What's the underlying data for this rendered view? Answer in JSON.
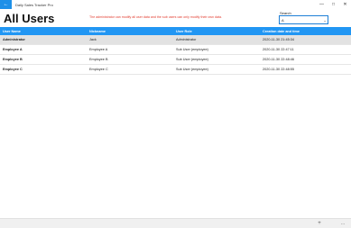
{
  "window": {
    "app_title": "Daily Sales Tracker Pro",
    "back_icon": "←",
    "minimize_icon": "—",
    "maximize_icon": "□",
    "close_icon": "✕"
  },
  "header": {
    "title": "All Users",
    "notice": "The administrator can modify all user data and the sub users can only modify their own data."
  },
  "search": {
    "label": "Search",
    "value": "A",
    "chevron": "⌄"
  },
  "table": {
    "columns": [
      "User Name",
      "Nickname",
      "User Role",
      "Creation date and time"
    ],
    "rows": [
      {
        "name": "Administrator",
        "nickname": "Jack",
        "role": "Administrator",
        "created": "2020-11-30 21:45:34"
      },
      {
        "name": "Employee A",
        "nickname": "Employee A",
        "role": "Sub User (employee)",
        "created": "2020-11-30 22:47:11"
      },
      {
        "name": "Employee B",
        "nickname": "Employee B",
        "role": "Sub User (employee)",
        "created": "2020-11-30 22:48:46"
      },
      {
        "name": "Employee C",
        "nickname": "Employee C",
        "role": "Sub User (employee)",
        "created": "2020-11-30 22:48:55"
      }
    ]
  },
  "bottombar": {
    "add_icon": "+",
    "more_icon": "…"
  },
  "colors": {
    "accent": "#2196f3",
    "notice": "#e23b2e",
    "selected_row": "#e2e2e2"
  }
}
